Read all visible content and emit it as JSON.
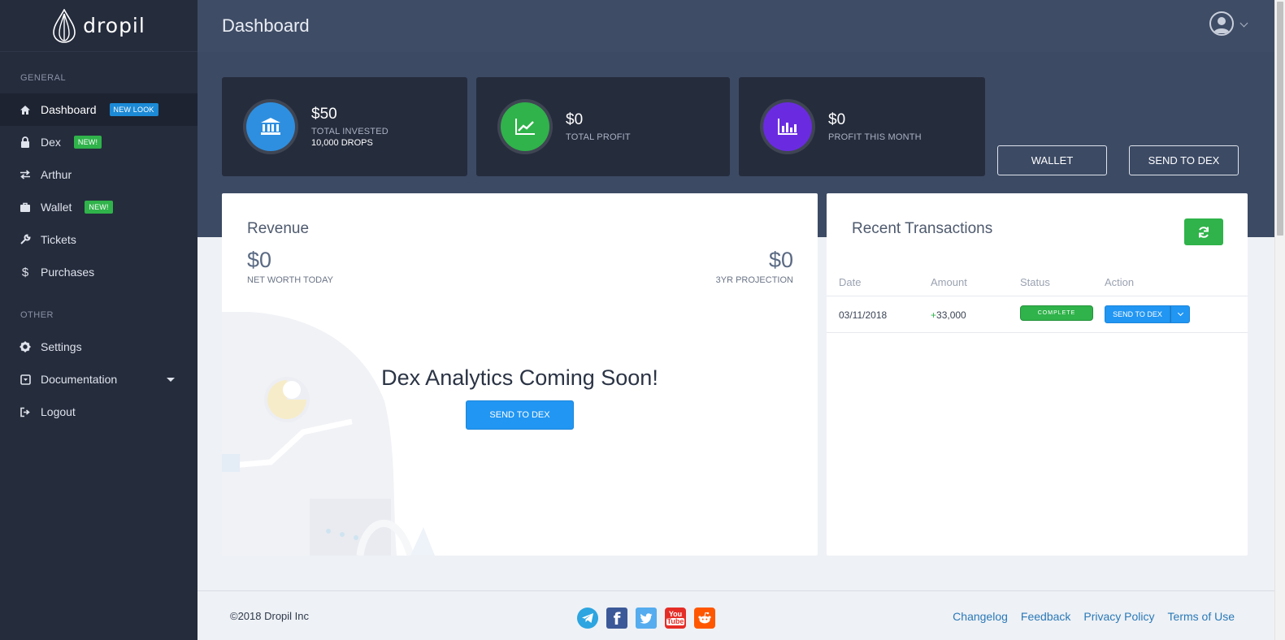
{
  "brand": {
    "name": "dropil"
  },
  "header": {
    "title": "Dashboard"
  },
  "sidebar": {
    "general_label": "GENERAL",
    "other_label": "OTHER",
    "items": [
      {
        "label": "Dashboard",
        "icon": "home-icon",
        "badge": "NEW LOOK",
        "badge_color": "#1c8ad6",
        "active": true
      },
      {
        "label": "Dex",
        "icon": "lock-icon",
        "badge": "NEW!",
        "badge_color": "#2fb34a"
      },
      {
        "label": "Arthur",
        "icon": "exchange-icon"
      },
      {
        "label": "Wallet",
        "icon": "briefcase-icon",
        "badge": "NEW!",
        "badge_color": "#2fb34a"
      },
      {
        "label": "Tickets",
        "icon": "wrench-icon"
      },
      {
        "label": "Purchases",
        "icon": "dollar-icon"
      }
    ],
    "other_items": [
      {
        "label": "Settings",
        "icon": "gear-icon"
      },
      {
        "label": "Documentation",
        "icon": "caret-square-icon"
      },
      {
        "label": "Logout",
        "icon": "sign-out-icon"
      }
    ]
  },
  "stats": [
    {
      "value": "$50",
      "label": "TOTAL INVESTED",
      "sub": "10,000 DROPS",
      "color": "#2e8fe0",
      "icon": "bank-icon"
    },
    {
      "value": "$0",
      "label": "TOTAL PROFIT",
      "color": "#2fb34a",
      "icon": "line-chart-icon"
    },
    {
      "value": "$0",
      "label": "PROFIT THIS MONTH",
      "color": "#6a2be0",
      "icon": "bar-chart-icon"
    }
  ],
  "actions": {
    "wallet": "WALLET",
    "send_to_dex": "SEND TO DEX"
  },
  "revenue": {
    "title": "Revenue",
    "net_worth_value": "$0",
    "net_worth_label": "NET WORTH TODAY",
    "projection_value": "$0",
    "projection_label": "3YR PROJECTION",
    "coming_soon": "Dex Analytics Coming Soon!",
    "button": "SEND TO DEX"
  },
  "transactions": {
    "title": "Recent Transactions",
    "columns": [
      "Date",
      "Amount",
      "Status",
      "Action"
    ],
    "rows": [
      {
        "date": "03/11/2018",
        "amount": "33,000",
        "status": "COMPLETE",
        "action": "SEND TO DEX"
      }
    ]
  },
  "footer": {
    "copyright": "©2018 Dropil Inc",
    "links": [
      "Changelog",
      "Feedback",
      "Privacy Policy",
      "Terms of Use"
    ],
    "socials": [
      "telegram-icon",
      "facebook-icon",
      "twitter-icon",
      "youtube-icon",
      "reddit-icon"
    ]
  }
}
